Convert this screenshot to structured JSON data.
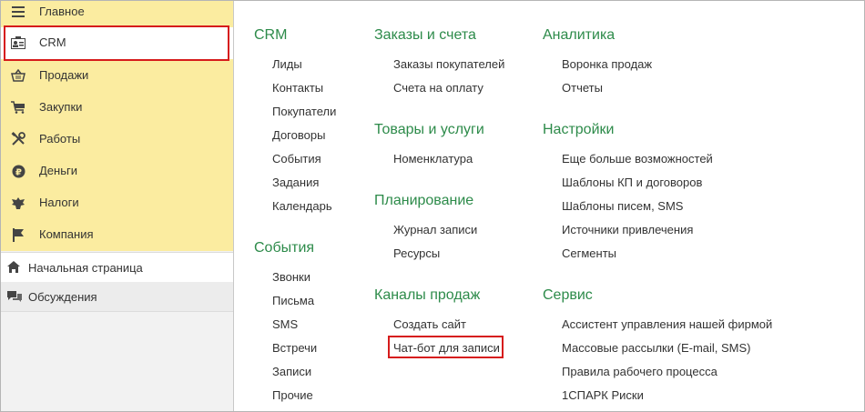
{
  "sidebar": {
    "sections": [
      {
        "label": "Главное",
        "icon": "menu-icon"
      },
      {
        "label": "CRM",
        "icon": "contact-card-icon"
      },
      {
        "label": "Продажи",
        "icon": "shopping-basket-icon"
      },
      {
        "label": "Закупки",
        "icon": "cart-icon"
      },
      {
        "label": "Работы",
        "icon": "tools-icon"
      },
      {
        "label": "Деньги",
        "icon": "ruble-coin-icon"
      },
      {
        "label": "Налоги",
        "icon": "eagle-emblem-icon"
      },
      {
        "label": "Компания",
        "icon": "flag-icon"
      }
    ],
    "selected": "CRM",
    "home_label": "Начальная страница",
    "discussions_label": "Обсуждения"
  },
  "colors": {
    "accent_green": "#2d8b4a",
    "highlight_red": "#d61b1b",
    "sections_bg": "#fbeca0"
  },
  "columns": [
    {
      "groups": [
        {
          "title": "CRM",
          "items": [
            "Лиды",
            "Контакты",
            "Покупатели",
            "Договоры",
            "События",
            "Задания",
            "Календарь"
          ]
        },
        {
          "title": "События",
          "items": [
            "Звонки",
            "Письма",
            "SMS",
            "Встречи",
            "Записи",
            "Прочие"
          ]
        }
      ]
    },
    {
      "groups": [
        {
          "title": "Заказы и счета",
          "items": [
            "Заказы покупателей",
            "Счета на оплату"
          ]
        },
        {
          "title": "Товары и услуги",
          "items": [
            "Номенклатура"
          ]
        },
        {
          "title": "Планирование",
          "items": [
            "Журнал записи",
            "Ресурсы"
          ]
        },
        {
          "title": "Каналы продаж",
          "items": [
            "Создать сайт",
            "Чат-бот для записи"
          ]
        }
      ]
    },
    {
      "groups": [
        {
          "title": "Аналитика",
          "items": [
            "Воронка продаж",
            "Отчеты"
          ]
        },
        {
          "title": "Настройки",
          "items": [
            "Еще больше возможностей",
            "Шаблоны КП и договоров",
            "Шаблоны писем, SMS",
            "Источники привлечения",
            "Сегменты"
          ]
        },
        {
          "title": "Сервис",
          "items": [
            "Ассистент управления нашей фирмой",
            "Массовые рассылки (E-mail, SMS)",
            "Правила рабочего процесса",
            "1СПАРК Риски"
          ]
        }
      ]
    }
  ]
}
